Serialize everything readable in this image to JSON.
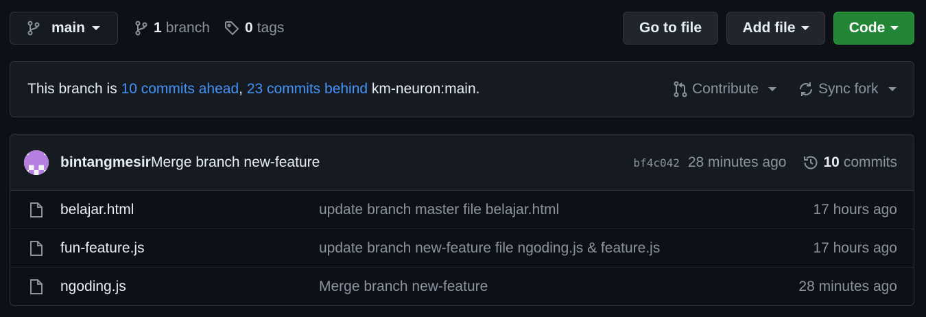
{
  "toolbar": {
    "branch_button": {
      "label": "main",
      "icon": "git-branch-icon"
    },
    "branches": {
      "count": "1",
      "label": "branch",
      "icon": "git-branch-icon"
    },
    "tags": {
      "count": "0",
      "label": "tags",
      "icon": "tag-icon"
    },
    "go_to_file_label": "Go to file",
    "add_file_label": "Add file",
    "code_label": "Code"
  },
  "banner": {
    "prefix": "This branch is ",
    "ahead": "10 commits ahead",
    "separator": ", ",
    "behind": "23 commits behind",
    "upstream": " km-neuron:main.",
    "contribute_label": "Contribute",
    "sync_label": "Sync fork"
  },
  "latest_commit": {
    "author": "bintangmesir",
    "message": "Merge branch new-feature",
    "sha": "bf4c042",
    "time": "28 minutes ago",
    "commit_count": "10",
    "commits_label": "commits"
  },
  "files": [
    {
      "name": "belajar.html",
      "message": "update branch master file belajar.html",
      "time": "17 hours ago"
    },
    {
      "name": "fun-feature.js",
      "message": "update branch new-feature file ngoding.js & feature.js",
      "time": "17 hours ago"
    },
    {
      "name": "ngoding.js",
      "message": "Merge branch new-feature",
      "time": "28 minutes ago"
    }
  ],
  "colors": {
    "background": "#0d1117",
    "panel": "#161b22",
    "border": "#30363d",
    "link_blue": "#4493f8",
    "muted_text": "#8b949e",
    "primary_green": "#238636",
    "avatar_purple": "#b77ee2"
  }
}
